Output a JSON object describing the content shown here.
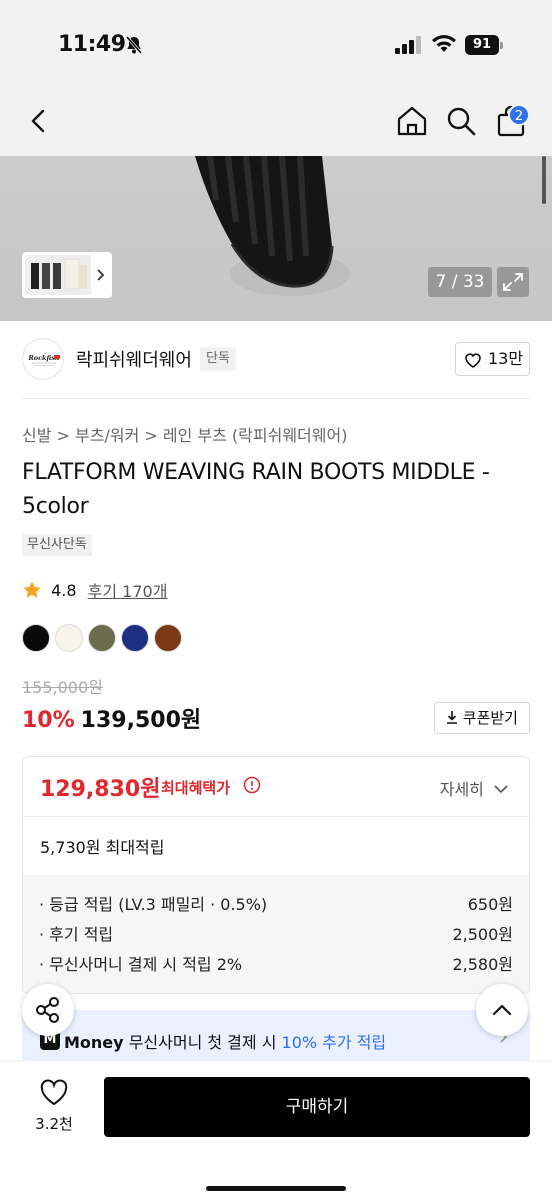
{
  "status_bar": {
    "time": "11:49",
    "battery": "91"
  },
  "header": {
    "cart_count": "2"
  },
  "gallery": {
    "counter": "7 / 33"
  },
  "brand": {
    "name": "락피쉬웨더웨어",
    "tag": "단독",
    "likes": "13만",
    "logo_text": "Rockfish"
  },
  "breadcrumb": "신발 > 부츠/워커 > 레인 부츠 (락피쉬웨더웨어)",
  "product": {
    "title": "FLATFORM WEAVING RAIN BOOTS MIDDLE - 5color",
    "exclusive_tag": "무신사단독",
    "rating": "4.8",
    "reviews": "후기 170개",
    "colors": [
      "#0a0a0a",
      "#f7f4ec",
      "#6b6b4e",
      "#1e2f82",
      "#7a3a14"
    ]
  },
  "pricing": {
    "original": "155,000원",
    "discount": "10%",
    "price": "139,500원",
    "coupon_label": "쿠폰받기"
  },
  "benefit": {
    "max_price": "129,830원",
    "max_label": "최대혜택가",
    "detail_label": "자세히",
    "points_total": "5,730원 최대적립",
    "rows": [
      {
        "label": "· 등급 적립 (LV.3 패밀리 · 0.5%)",
        "value": "650원"
      },
      {
        "label": "· 후기 적립",
        "value": "2,500원"
      },
      {
        "label": "· 무신사머니 결제 시 적립 2%",
        "value": "2,580원"
      }
    ]
  },
  "money_banner": {
    "logo": "M",
    "brand": "Money",
    "text": "무신사머니 첫 결제 시",
    "highlight": "10% 추가 적립"
  },
  "bottom_bar": {
    "wish_count": "3.2천",
    "buy_label": "구매하기"
  }
}
